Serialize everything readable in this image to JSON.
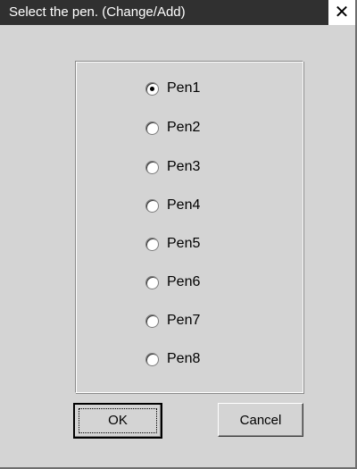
{
  "window": {
    "title": "Select the pen. (Change/Add)",
    "close_glyph": "✕"
  },
  "pens": {
    "selected": "Pen1",
    "options": [
      "Pen1",
      "Pen2",
      "Pen3",
      "Pen4",
      "Pen5",
      "Pen6",
      "Pen7",
      "Pen8"
    ]
  },
  "buttons": {
    "ok_label": "OK",
    "cancel_label": "Cancel"
  }
}
